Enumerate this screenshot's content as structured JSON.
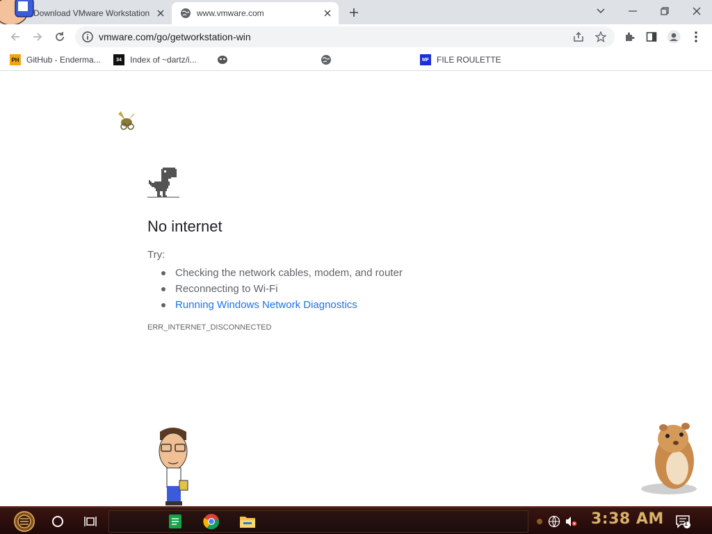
{
  "browser": {
    "tabs": [
      {
        "title": "Download VMware Workstation",
        "active": false
      },
      {
        "title": "www.vmware.com",
        "active": true
      }
    ],
    "address_bar": {
      "url": "vmware.com/go/getworkstation-win"
    },
    "bookmarks": [
      {
        "label": "GitHub - Enderma...",
        "favicon": "PH"
      },
      {
        "label": "Index of ~dartz/i...",
        "favicon": "34"
      },
      {
        "label": "",
        "favicon": "mask"
      },
      {
        "label": "",
        "favicon": "globe"
      },
      {
        "label": "FILE ROULETTE",
        "favicon": "MF"
      }
    ]
  },
  "error_page": {
    "heading": "No internet",
    "try_label": "Try:",
    "suggestions": [
      {
        "text": "Checking the network cables, modem, and router",
        "link": false
      },
      {
        "text": "Reconnecting to Wi-Fi",
        "link": false
      },
      {
        "text": "Running Windows Network Diagnostics",
        "link": true
      }
    ],
    "error_code": "ERR_INTERNET_DISCONNECTED"
  },
  "taskbar": {
    "clock": "3:38 AM",
    "notification_count": "1"
  },
  "colors": {
    "link": "#1a73e8",
    "clock": "#d8b36a",
    "taskbar": "#2a0e0c"
  }
}
